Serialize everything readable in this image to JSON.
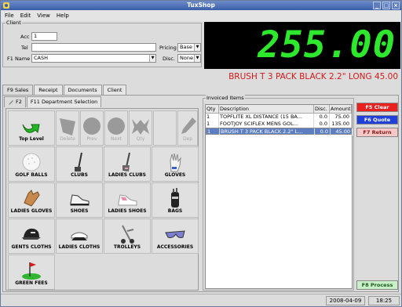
{
  "window": {
    "title": "TuxShop"
  },
  "menu": [
    {
      "label": "File"
    },
    {
      "label": "Edit"
    },
    {
      "label": "View"
    },
    {
      "label": "Help"
    }
  ],
  "client": {
    "legend": "Client",
    "acc_label": "Acc",
    "acc_value": "1",
    "tel_label": "Tel",
    "tel_value": "",
    "name_label": "F1 Name",
    "name_value": "CASH",
    "pricing_label": "Pricing",
    "pricing_value": "Base",
    "disc_label": "Disc.",
    "disc_value": "None"
  },
  "display": {
    "amount": "255.00",
    "amount_color": "#2ee82e",
    "item_line": "BRUSH T 3 PACK BLACK 2.2\" LONG  45.00",
    "item_line_color": "#d21a1a"
  },
  "tabs": [
    {
      "label": "F9 Sales"
    },
    {
      "label": "Receipt"
    },
    {
      "label": "Documents"
    },
    {
      "label": "Client"
    }
  ],
  "subtabs": [
    {
      "label": "F2"
    },
    {
      "label": "F11 Department Selection"
    }
  ],
  "toolbar": [
    {
      "label": "Top Level",
      "icon": "green-arrow-icon"
    },
    {
      "label": "Delete",
      "icon": "delete-icon"
    },
    {
      "label": "Prev",
      "icon": "prev-icon"
    },
    {
      "label": "Next",
      "icon": "next-icon"
    },
    {
      "label": "Qty",
      "icon": "qty-icon"
    },
    {
      "label": "Dep",
      "icon": "dep-icon"
    }
  ],
  "departments": [
    {
      "label": "GOLF BALLS",
      "icon": "golf-ball-icon"
    },
    {
      "label": "CLUBS",
      "icon": "golf-club-icon"
    },
    {
      "label": "LADIES CLUBS",
      "icon": "ladies-club-icon"
    },
    {
      "label": "GLOVES",
      "icon": "glove-icon"
    },
    {
      "label": "LADIES GLOVES",
      "icon": "ladies-glove-icon"
    },
    {
      "label": "SHOES",
      "icon": "shoe-icon"
    },
    {
      "label": "LADIES SHOES",
      "icon": "ladies-shoe-icon"
    },
    {
      "label": "BAGS",
      "icon": "golf-bag-icon"
    },
    {
      "label": "GENTS CLOTHS",
      "icon": "cap-icon"
    },
    {
      "label": "LADIES CLOTHS",
      "icon": "visor-icon"
    },
    {
      "label": "TROLLEYS",
      "icon": "trolley-icon"
    },
    {
      "label": "ACCESSORIES",
      "icon": "sunglasses-icon"
    },
    {
      "label": "GREEN FEES",
      "icon": "green-flag-icon"
    }
  ],
  "invoiced": {
    "legend": "Invoiced Items",
    "columns": [
      "Qty",
      "Description",
      "Disc.",
      "Amount"
    ],
    "rows": [
      {
        "qty": "1",
        "description": "TOPFLITE XL DISTANCE (15 BA...",
        "disc": "0.0",
        "amount": "75.00"
      },
      {
        "qty": "1",
        "description": "FOOTJOY SCIFLEX MENS GOL...",
        "disc": "0.0",
        "amount": "135.00"
      },
      {
        "qty": "1",
        "description": "BRUSH T 3 PACK BLACK 2.2\" L...",
        "disc": "0.0",
        "amount": "45.00"
      }
    ],
    "selected_row": 2
  },
  "function_buttons": [
    {
      "label": "F5 Clear",
      "bg": "#e8211f",
      "fg": "#ffffff"
    },
    {
      "label": "F6 Quote",
      "bg": "#1f3fd8",
      "fg": "#ffffff"
    },
    {
      "label": "F7 Return",
      "bg": "#f7c8c8",
      "fg": "#8a1515"
    },
    {
      "label": "F8 Process",
      "bg": "#c9f0c9",
      "fg": "#1a5a1a"
    }
  ],
  "status": {
    "date": "2008-04-09",
    "time": "18:25"
  }
}
